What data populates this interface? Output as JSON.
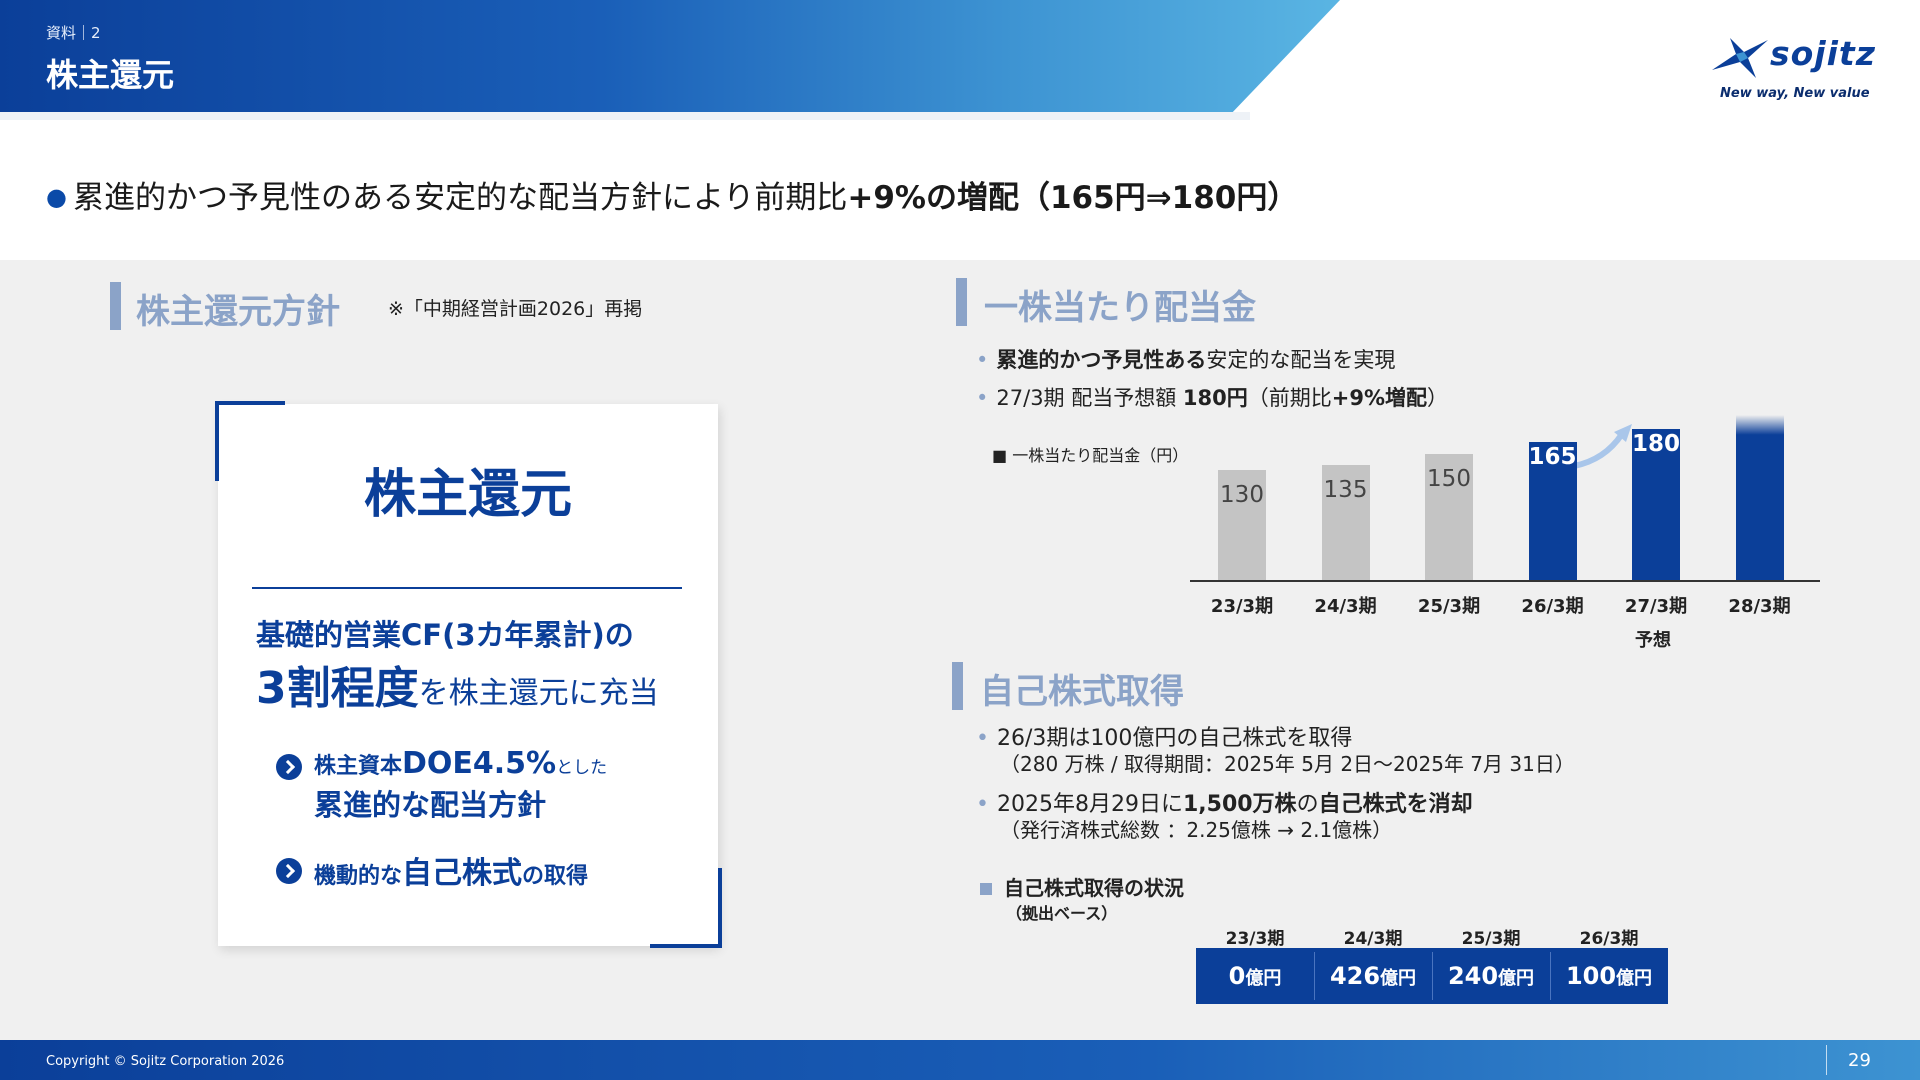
{
  "header": {
    "sub": "資料｜2",
    "title": "株主還元"
  },
  "logo": {
    "name": "sojitz",
    "tagline": "New way, New value"
  },
  "headline": {
    "prefix": "累進的かつ予見性のある安定的な配当方針により前期比",
    "bold": "+9%の増配（165円⇒180円）"
  },
  "policy": {
    "section_title": "株主還元方針",
    "note": "※「中期経営計画2026」再掲",
    "card_title": "株主還元",
    "line1": "基礎的営業CF(3カ年累計)の",
    "line2_big": "3割程度",
    "line2_rest": "を株主還元に充当",
    "bullet1_a": "株主資本",
    "bullet1_b": "DOE4.5%",
    "bullet1_c": "とした",
    "bullet1_line2": "累進的な配当方針",
    "bullet2_a": "機動的な",
    "bullet2_b": "自己株式",
    "bullet2_c": "の取得"
  },
  "dividend": {
    "section_title": "一株当たり配当金",
    "b1_bold": "累進的かつ予見性ある",
    "b1_rest": "安定的な配当を実現",
    "b2_a": "27/3期 配当予想額 ",
    "b2_b": "180円",
    "b2_c": "（前期比",
    "b2_d": "+9%増配",
    "b2_e": "）",
    "legend": "■ 一株当たり配当金（円）",
    "forecast_label": "予想"
  },
  "chart_data": {
    "type": "bar",
    "title": "",
    "series_label": "一株当たり配当金（円）",
    "categories": [
      "23/3期",
      "24/3期",
      "25/3期",
      "26/3期",
      "27/3期",
      "28/3期"
    ],
    "values": [
      130,
      135,
      150,
      165,
      180,
      null
    ],
    "labels": [
      "130",
      "135",
      "150",
      "165",
      "180",
      ""
    ],
    "colors": [
      "#c4c4c4",
      "#c4c4c4",
      "#c4c4c4",
      "#0b3f99",
      "#0b3f99",
      "#0b3f99"
    ],
    "forecast_index": 4,
    "ylim": [
      0,
      200
    ]
  },
  "treasury": {
    "section_title": "自己株式取得",
    "b1": "26/3期は100億円の自己株式を取得",
    "b1_sub": "（280 万株 / 取得期間：2025年 5月 2日～2025年 7月 31日）",
    "b2_a": "2025年8月29日に",
    "b2_b": "1,500万株",
    "b2_c": "の",
    "b2_d": "自己株式を消却",
    "b2_sub": "（発行済株式総数 ：2.25億株 → 2.1億株）",
    "status_title": "自己株式取得の状況",
    "status_sub": "（拠出ベース）",
    "unit": "億円",
    "table": [
      {
        "period": "23/3期",
        "value": "0"
      },
      {
        "period": "24/3期",
        "value": "426"
      },
      {
        "period": "25/3期",
        "value": "240"
      },
      {
        "period": "26/3期",
        "value": "100"
      }
    ]
  },
  "footer": {
    "copyright": "Copyright © Sojitz Corporation 2026",
    "page": "29"
  }
}
